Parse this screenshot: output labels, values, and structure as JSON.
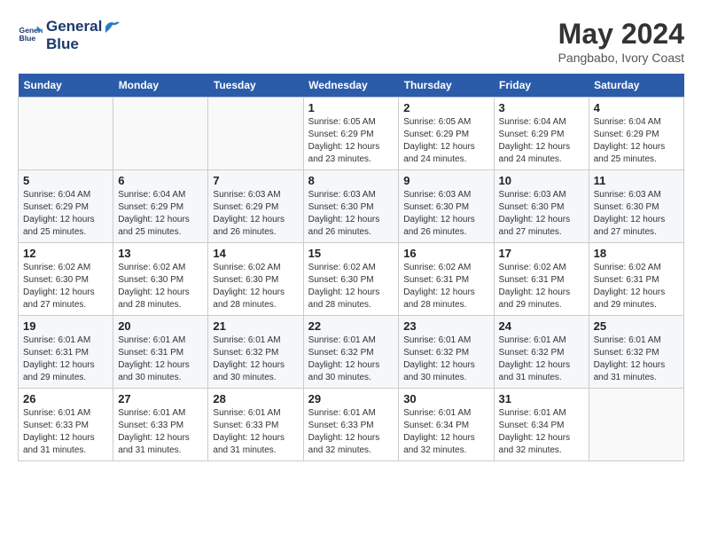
{
  "header": {
    "logo_line1": "General",
    "logo_line2": "Blue",
    "month_year": "May 2024",
    "location": "Pangbabo, Ivory Coast"
  },
  "days_of_week": [
    "Sunday",
    "Monday",
    "Tuesday",
    "Wednesday",
    "Thursday",
    "Friday",
    "Saturday"
  ],
  "weeks": [
    [
      {
        "num": "",
        "info": ""
      },
      {
        "num": "",
        "info": ""
      },
      {
        "num": "",
        "info": ""
      },
      {
        "num": "1",
        "info": "Sunrise: 6:05 AM\nSunset: 6:29 PM\nDaylight: 12 hours\nand 23 minutes."
      },
      {
        "num": "2",
        "info": "Sunrise: 6:05 AM\nSunset: 6:29 PM\nDaylight: 12 hours\nand 24 minutes."
      },
      {
        "num": "3",
        "info": "Sunrise: 6:04 AM\nSunset: 6:29 PM\nDaylight: 12 hours\nand 24 minutes."
      },
      {
        "num": "4",
        "info": "Sunrise: 6:04 AM\nSunset: 6:29 PM\nDaylight: 12 hours\nand 25 minutes."
      }
    ],
    [
      {
        "num": "5",
        "info": "Sunrise: 6:04 AM\nSunset: 6:29 PM\nDaylight: 12 hours\nand 25 minutes."
      },
      {
        "num": "6",
        "info": "Sunrise: 6:04 AM\nSunset: 6:29 PM\nDaylight: 12 hours\nand 25 minutes."
      },
      {
        "num": "7",
        "info": "Sunrise: 6:03 AM\nSunset: 6:29 PM\nDaylight: 12 hours\nand 26 minutes."
      },
      {
        "num": "8",
        "info": "Sunrise: 6:03 AM\nSunset: 6:30 PM\nDaylight: 12 hours\nand 26 minutes."
      },
      {
        "num": "9",
        "info": "Sunrise: 6:03 AM\nSunset: 6:30 PM\nDaylight: 12 hours\nand 26 minutes."
      },
      {
        "num": "10",
        "info": "Sunrise: 6:03 AM\nSunset: 6:30 PM\nDaylight: 12 hours\nand 27 minutes."
      },
      {
        "num": "11",
        "info": "Sunrise: 6:03 AM\nSunset: 6:30 PM\nDaylight: 12 hours\nand 27 minutes."
      }
    ],
    [
      {
        "num": "12",
        "info": "Sunrise: 6:02 AM\nSunset: 6:30 PM\nDaylight: 12 hours\nand 27 minutes."
      },
      {
        "num": "13",
        "info": "Sunrise: 6:02 AM\nSunset: 6:30 PM\nDaylight: 12 hours\nand 28 minutes."
      },
      {
        "num": "14",
        "info": "Sunrise: 6:02 AM\nSunset: 6:30 PM\nDaylight: 12 hours\nand 28 minutes."
      },
      {
        "num": "15",
        "info": "Sunrise: 6:02 AM\nSunset: 6:30 PM\nDaylight: 12 hours\nand 28 minutes."
      },
      {
        "num": "16",
        "info": "Sunrise: 6:02 AM\nSunset: 6:31 PM\nDaylight: 12 hours\nand 28 minutes."
      },
      {
        "num": "17",
        "info": "Sunrise: 6:02 AM\nSunset: 6:31 PM\nDaylight: 12 hours\nand 29 minutes."
      },
      {
        "num": "18",
        "info": "Sunrise: 6:02 AM\nSunset: 6:31 PM\nDaylight: 12 hours\nand 29 minutes."
      }
    ],
    [
      {
        "num": "19",
        "info": "Sunrise: 6:01 AM\nSunset: 6:31 PM\nDaylight: 12 hours\nand 29 minutes."
      },
      {
        "num": "20",
        "info": "Sunrise: 6:01 AM\nSunset: 6:31 PM\nDaylight: 12 hours\nand 30 minutes."
      },
      {
        "num": "21",
        "info": "Sunrise: 6:01 AM\nSunset: 6:32 PM\nDaylight: 12 hours\nand 30 minutes."
      },
      {
        "num": "22",
        "info": "Sunrise: 6:01 AM\nSunset: 6:32 PM\nDaylight: 12 hours\nand 30 minutes."
      },
      {
        "num": "23",
        "info": "Sunrise: 6:01 AM\nSunset: 6:32 PM\nDaylight: 12 hours\nand 30 minutes."
      },
      {
        "num": "24",
        "info": "Sunrise: 6:01 AM\nSunset: 6:32 PM\nDaylight: 12 hours\nand 31 minutes."
      },
      {
        "num": "25",
        "info": "Sunrise: 6:01 AM\nSunset: 6:32 PM\nDaylight: 12 hours\nand 31 minutes."
      }
    ],
    [
      {
        "num": "26",
        "info": "Sunrise: 6:01 AM\nSunset: 6:33 PM\nDaylight: 12 hours\nand 31 minutes."
      },
      {
        "num": "27",
        "info": "Sunrise: 6:01 AM\nSunset: 6:33 PM\nDaylight: 12 hours\nand 31 minutes."
      },
      {
        "num": "28",
        "info": "Sunrise: 6:01 AM\nSunset: 6:33 PM\nDaylight: 12 hours\nand 31 minutes."
      },
      {
        "num": "29",
        "info": "Sunrise: 6:01 AM\nSunset: 6:33 PM\nDaylight: 12 hours\nand 32 minutes."
      },
      {
        "num": "30",
        "info": "Sunrise: 6:01 AM\nSunset: 6:34 PM\nDaylight: 12 hours\nand 32 minutes."
      },
      {
        "num": "31",
        "info": "Sunrise: 6:01 AM\nSunset: 6:34 PM\nDaylight: 12 hours\nand 32 minutes."
      },
      {
        "num": "",
        "info": ""
      }
    ]
  ]
}
